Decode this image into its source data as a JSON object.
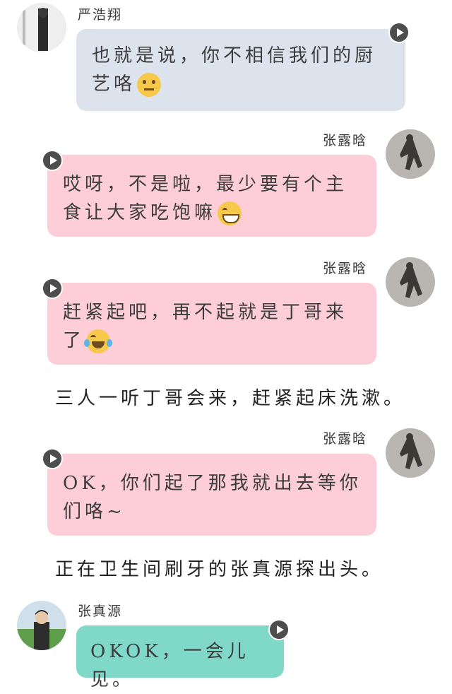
{
  "colors": {
    "bubble_gray": "#dde3ec",
    "bubble_pink": "#fdcdd8",
    "bubble_teal": "#7fd8c8",
    "play_button": "#4d4d4d"
  },
  "messages": [
    {
      "sender": "严浩翔",
      "line1": "也就是说，你不相信我们的厨",
      "line2": "艺咯",
      "emoji": "neutral-face-emoji"
    },
    {
      "sender": "张露晗",
      "line1": "哎呀，不是啦，最少要有个主",
      "line2": "食让大家吃饱嘛",
      "emoji": "grinning-face-emoji"
    },
    {
      "sender": "张露晗",
      "line1": "赶紧起吧，再不起就是丁哥来",
      "line2": "了",
      "emoji": "tears-of-joy-emoji"
    },
    {
      "sender": "张露晗",
      "line1": "OK，你们起了那我就出去等你",
      "line2": "们咯~"
    },
    {
      "sender": "张真源",
      "line1": "OKOK，一会儿见。"
    }
  ],
  "narration": [
    "三人一听丁哥会来，赶紧起床洗漱。",
    "正在卫生间刷牙的张真源探出头。"
  ]
}
